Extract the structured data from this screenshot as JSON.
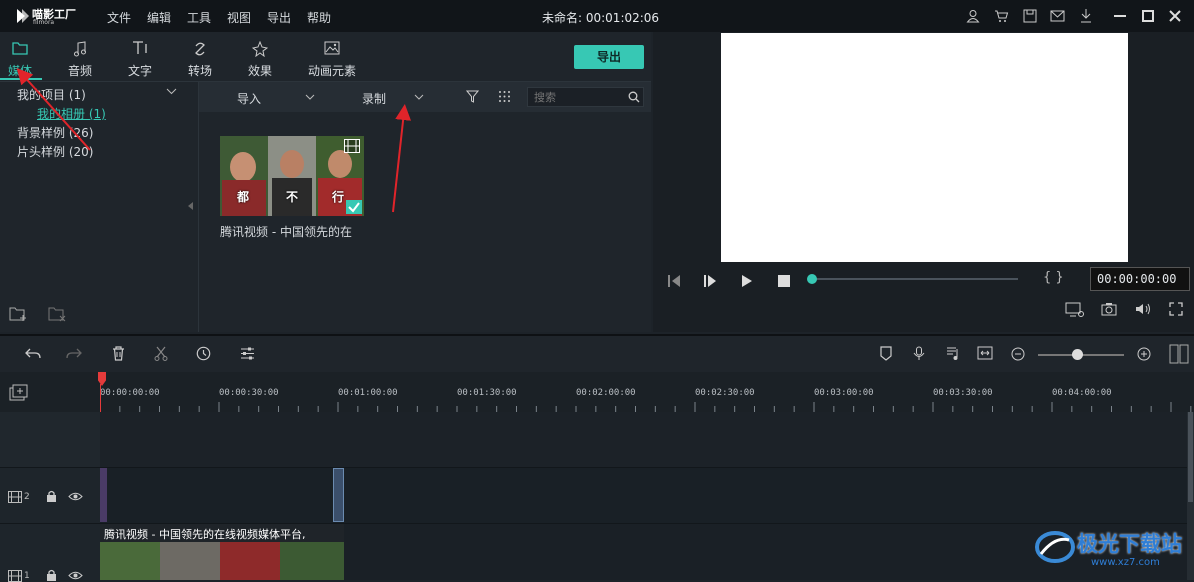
{
  "app": {
    "logo_text": "喵影工厂",
    "logo_sub": "filmora",
    "title": "未命名: 00:01:02:06"
  },
  "menu": [
    "文件",
    "编辑",
    "工具",
    "视图",
    "导出",
    "帮助"
  ],
  "tabs": [
    {
      "label": "媒体",
      "icon": "folder-icon"
    },
    {
      "label": "音频",
      "icon": "music-note-icon"
    },
    {
      "label": "文字",
      "icon": "text-icon"
    },
    {
      "label": "转场",
      "icon": "transition-icon"
    },
    {
      "label": "效果",
      "icon": "effects-icon"
    },
    {
      "label": "动画元素",
      "icon": "image-icon"
    }
  ],
  "export_label": "导出",
  "tree": {
    "project": "我的项目 (1)",
    "album": "我的相册 (1)",
    "bg": "背景样例 (26)",
    "intro": "片头样例 (20)"
  },
  "media_toolbar": {
    "import": "导入",
    "record": "录制",
    "search_placeholder": "搜索"
  },
  "media_item": {
    "name": "腾讯视频 - 中国领先的在",
    "chars": [
      "都",
      "不",
      "行"
    ]
  },
  "preview": {
    "timecode": "00:00:00:00",
    "brackets": "{ }"
  },
  "ruler": [
    "00:00:00:00",
    "00:00:30:00",
    "00:01:00:00",
    "00:01:30:00",
    "00:02:00:00",
    "00:02:30:00",
    "00:03:00:00",
    "00:03:30:00",
    "00:04:00:00"
  ],
  "tracks": [
    {
      "number": "2"
    },
    {
      "number": "1"
    }
  ],
  "clip_title": "腾讯视频 - 中国领先的在线视频媒体平台,",
  "watermark": {
    "text": "极光下载站",
    "url": "www.xz7.com"
  },
  "colors": {
    "accent": "#37c8b4",
    "arrow": "#e0242a"
  }
}
